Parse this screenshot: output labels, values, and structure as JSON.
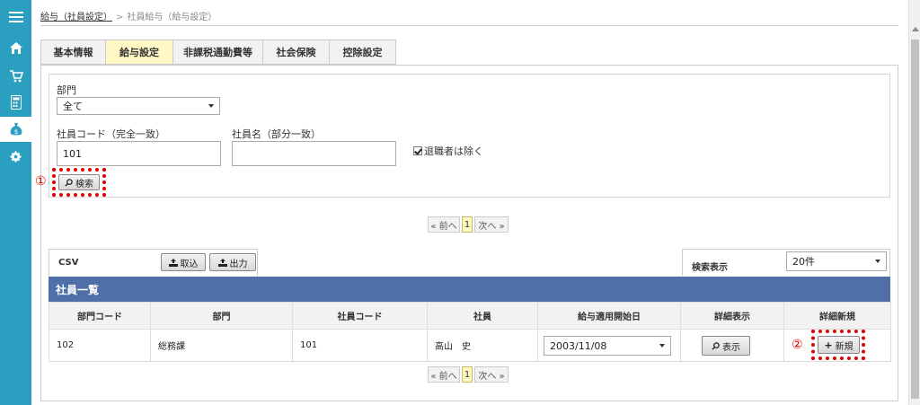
{
  "breadcrumb": {
    "parent": "給与（社員設定）",
    "current": "社員給与（給与設定）"
  },
  "tabs": [
    "基本情報",
    "給与設定",
    "非課税通勤費等",
    "社会保険",
    "控除設定"
  ],
  "active_tab": "給与設定",
  "search": {
    "dept_label": "部門",
    "dept_value": "全て",
    "code_label": "社員コード（完全一致）",
    "code_value": "101",
    "name_label": "社員名（部分一致）",
    "name_value": "",
    "exclude_retired": "退職者は除く",
    "search_button": "検索",
    "marker": "①"
  },
  "pager": {
    "prev": "« 前へ",
    "page": "1",
    "next": "次へ »"
  },
  "csv": {
    "label": "CSV",
    "import_button": "取込",
    "export_button": "出力"
  },
  "display": {
    "label": "検索表示",
    "value": "20件"
  },
  "list": {
    "title": "社員一覧",
    "columns": [
      "部門コード",
      "部門",
      "社員コード",
      "社員",
      "給与適用開始日",
      "詳細表示",
      "詳細新規"
    ],
    "rows": [
      {
        "dept_code": "102",
        "dept": "総務課",
        "emp_code": "101",
        "emp_name": "高山　史",
        "start_date": "2003/11/08",
        "show_button": "表示",
        "new_button": "新規",
        "marker": "②"
      }
    ]
  },
  "colors": {
    "sidebar": "#2a9fc0",
    "list_header": "#4f6fa8",
    "active_tab": "#fff8c4",
    "highlight": "#e00000"
  }
}
